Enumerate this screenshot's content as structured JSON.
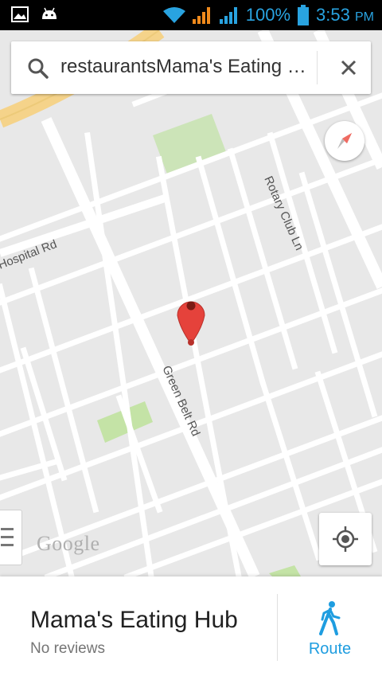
{
  "status_bar": {
    "battery": "100%",
    "time": "3:53",
    "ampm": "PM"
  },
  "search": {
    "query": "restaurantsMama's Eating Hub"
  },
  "map": {
    "street_labels": [
      "Hospital Rd",
      "Rotary Club Ln",
      "Green Belt Rd"
    ],
    "logo": "Google"
  },
  "place": {
    "name": "Mama's Eating Hub",
    "reviews": "No reviews",
    "route_label": "Route"
  },
  "colors": {
    "accent": "#1e9de0",
    "pin": "#e5423b",
    "park": "#cce4b8",
    "highway": "#f5d38a"
  }
}
